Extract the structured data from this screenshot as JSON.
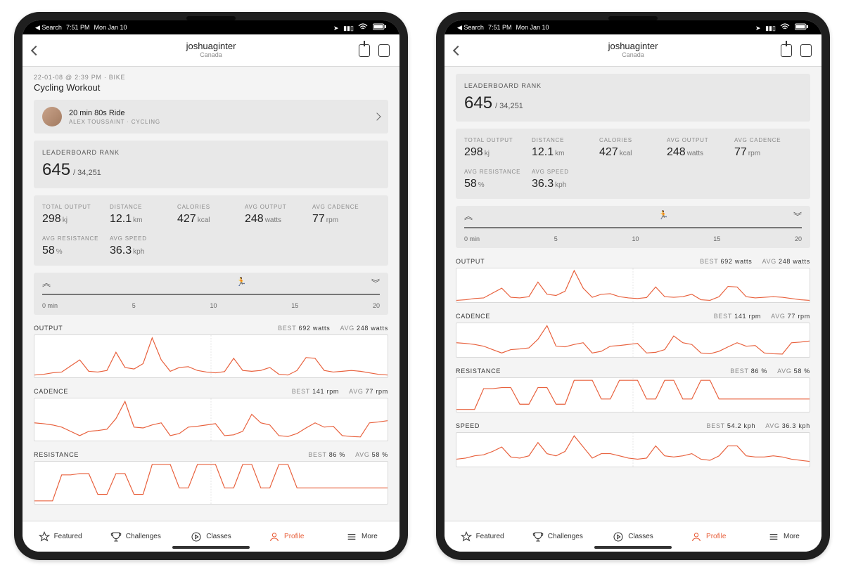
{
  "status": {
    "back": "◀ Search",
    "time": "7:51 PM",
    "date": "Mon Jan 10"
  },
  "user": {
    "name": "joshuaginter",
    "location": "Canada"
  },
  "workout": {
    "meta": "22-01-08 @ 2:39 PM  ·  BIKE",
    "title": "Cycling Workout"
  },
  "class": {
    "title": "20 min 80s Ride",
    "sub": "ALEX TOUSSAINT  ·  CYCLING"
  },
  "rank": {
    "label": "LEADERBOARD RANK",
    "value": "645",
    "total": "/ 34,251"
  },
  "metrics": [
    {
      "label": "TOTAL OUTPUT",
      "value": "298",
      "unit": "kj"
    },
    {
      "label": "DISTANCE",
      "value": "12.1",
      "unit": "km"
    },
    {
      "label": "CALORIES",
      "value": "427",
      "unit": "kcal"
    },
    {
      "label": "AVG OUTPUT",
      "value": "248",
      "unit": "watts"
    },
    {
      "label": "AVG CADENCE",
      "value": "77",
      "unit": "rpm"
    },
    {
      "label": "AVG RESISTANCE",
      "value": "58",
      "unit": "%"
    },
    {
      "label": "AVG SPEED",
      "value": "36.3",
      "unit": "kph"
    }
  ],
  "timeline": {
    "ticks": [
      "0 min",
      "5",
      "10",
      "15",
      "20"
    ]
  },
  "charts": [
    {
      "name": "OUTPUT",
      "best_l": "BEST",
      "best_v": "692 watts",
      "avg_l": "AVG",
      "avg_v": "248 watts"
    },
    {
      "name": "CADENCE",
      "best_l": "BEST",
      "best_v": "141 rpm",
      "avg_l": "AVG",
      "avg_v": "77 rpm"
    },
    {
      "name": "RESISTANCE",
      "best_l": "BEST",
      "best_v": "86 %",
      "avg_l": "AVG",
      "avg_v": "58 %"
    },
    {
      "name": "SPEED",
      "best_l": "BEST",
      "best_v": "54.2 kph",
      "avg_l": "AVG",
      "avg_v": "36.3 kph"
    }
  ],
  "tabs": [
    {
      "label": "Featured"
    },
    {
      "label": "Challenges"
    },
    {
      "label": "Classes"
    },
    {
      "label": "Profile"
    },
    {
      "label": "More"
    }
  ],
  "chart_data": [
    {
      "type": "line",
      "title": "OUTPUT",
      "xlabel": "min",
      "ylabel": "watts",
      "x_range": [
        0,
        20
      ],
      "best": 692,
      "avg": 248,
      "values": [
        200,
        210,
        230,
        240,
        320,
        400,
        250,
        240,
        260,
        500,
        300,
        280,
        350,
        690,
        400,
        250,
        300,
        310,
        260,
        240,
        230,
        245,
        420,
        260,
        250,
        260,
        300,
        210,
        200,
        260,
        430,
        420,
        260,
        240,
        250,
        260,
        250,
        230,
        210,
        200
      ]
    },
    {
      "type": "line",
      "title": "CADENCE",
      "xlabel": "min",
      "ylabel": "rpm",
      "x_range": [
        0,
        20
      ],
      "best": 141,
      "avg": 77,
      "values": [
        90,
        88,
        85,
        80,
        70,
        60,
        70,
        72,
        75,
        100,
        140,
        80,
        78,
        85,
        90,
        60,
        65,
        80,
        82,
        85,
        88,
        60,
        62,
        70,
        110,
        90,
        85,
        60,
        58,
        65,
        78,
        90,
        80,
        82,
        60,
        58,
        57,
        90,
        92,
        95
      ]
    },
    {
      "type": "line",
      "title": "RESISTANCE",
      "xlabel": "min",
      "ylabel": "%",
      "x_range": [
        0,
        20
      ],
      "best": 86,
      "avg": 58,
      "values": [
        30,
        30,
        30,
        70,
        70,
        72,
        72,
        40,
        40,
        72,
        72,
        40,
        40,
        86,
        86,
        86,
        50,
        50,
        86,
        86,
        86,
        50,
        50,
        86,
        86,
        50,
        50,
        86,
        86,
        50,
        50,
        50,
        50,
        50,
        50,
        50,
        50,
        50,
        50,
        50
      ]
    },
    {
      "type": "line",
      "title": "SPEED",
      "xlabel": "min",
      "ylabel": "kph",
      "x_range": [
        0,
        20
      ],
      "best": 54.2,
      "avg": 36.3,
      "values": [
        33,
        34,
        36,
        37,
        40,
        44,
        35,
        34,
        36,
        48,
        38,
        36,
        40,
        54,
        44,
        34,
        38,
        38,
        36,
        34,
        33,
        34,
        45,
        36,
        35,
        36,
        38,
        33,
        32,
        36,
        45,
        45,
        36,
        35,
        35,
        36,
        35,
        33,
        32,
        31
      ]
    }
  ]
}
